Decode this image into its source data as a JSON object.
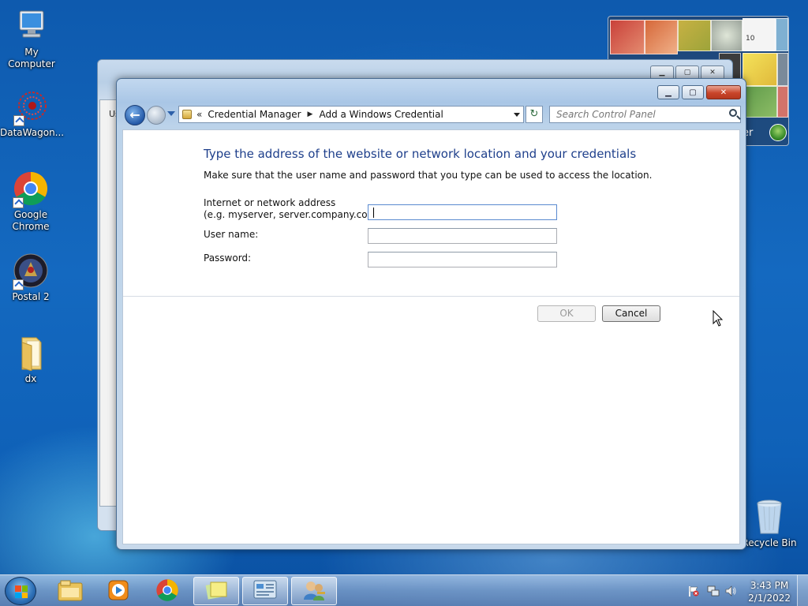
{
  "desktop": {
    "icons": [
      {
        "label": "My Computer",
        "icon": "computer-icon"
      },
      {
        "label": "DataWagon...",
        "icon": "datawagon-icon"
      },
      {
        "label": "Google Chrome",
        "icon": "chrome-icon"
      },
      {
        "label": "Postal 2",
        "icon": "postal2-icon"
      },
      {
        "label": "dx",
        "icon": "folder-icon"
      },
      {
        "label": "Recycle Bin",
        "icon": "recycle-bin-icon"
      }
    ]
  },
  "gadget": {
    "clock_text": "10",
    "corner_text": "er"
  },
  "bg_window": {
    "stub_text": "Us"
  },
  "window": {
    "controls": {
      "minimize": "▁",
      "maximize": "▢",
      "close": "✕"
    },
    "nav": {
      "back": "←"
    },
    "address": {
      "prefix": "«",
      "crumbs": [
        "Credential Manager",
        "Add a Windows Credential"
      ],
      "separator": "▶"
    },
    "refresh_glyph": "↻",
    "search": {
      "placeholder": "Search Control Panel"
    },
    "heading": "Type the address of the website or network location and your credentials",
    "subheading": "Make sure that the user name and password that you type can be used to access the location.",
    "form": {
      "address_label_line1": "Internet or network address",
      "address_label_line2": "(e.g. myserver, server.company.com):",
      "address_value": "",
      "username_label": "User name:",
      "username_value": "",
      "password_label": "Password:",
      "password_value": ""
    },
    "buttons": {
      "ok": "OK",
      "cancel": "Cancel"
    }
  },
  "taskbar": {
    "items": [
      "explorer-icon",
      "media-player-icon",
      "chrome-icon",
      "sticky-notes-icon",
      "control-panel-icon",
      "credential-users-icon"
    ],
    "clock": {
      "time": "3:43 PM",
      "date": "2/1/2022"
    },
    "tray": [
      "action-center-flag-icon",
      "network-icon",
      "volume-icon"
    ]
  },
  "colors": {
    "heading": "#1e3f8b",
    "desktop": "#1469c0",
    "close": "#c9452a"
  }
}
